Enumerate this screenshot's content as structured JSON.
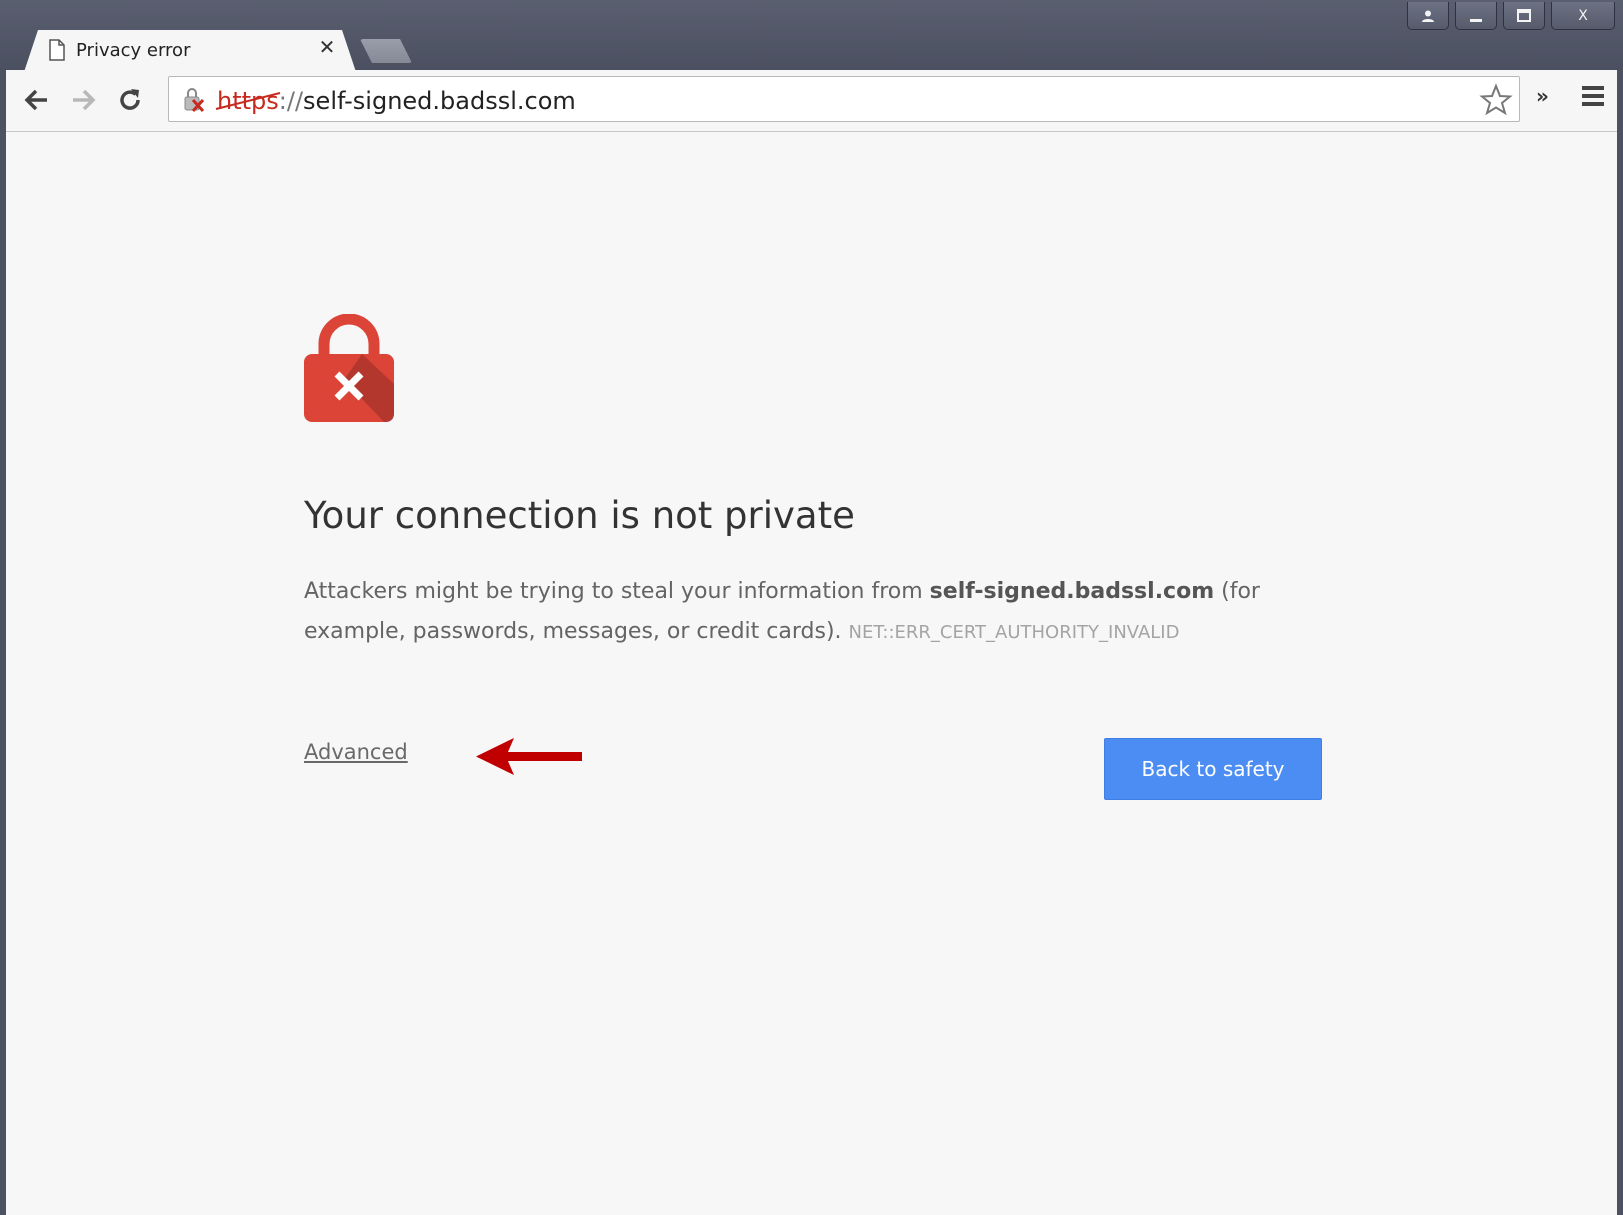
{
  "window": {
    "controls": [
      "profile",
      "minimize",
      "maximize",
      "close"
    ],
    "close_label": "X"
  },
  "tab": {
    "title": "Privacy error",
    "close_glyph": "✕",
    "icon": "page-icon"
  },
  "toolbar": {
    "url_scheme": "https",
    "url_separator": "://",
    "url_host": "self-signed.badssl.com",
    "extensions_glyph": "»"
  },
  "interstitial": {
    "heading": "Your connection is not private",
    "body_prefix": "Attackers might be trying to steal your information from ",
    "body_host": "self-signed.badssl.com",
    "body_suffix": " (for example, passwords, messages, or credit cards).",
    "error_code": "NET::ERR_CERT_AUTHORITY_INVALID",
    "advanced_link": "Advanced",
    "back_button": "Back to safety"
  },
  "colors": {
    "accent_button": "#4c8df4",
    "error_red": "#db4437",
    "annotation_arrow": "#c00000"
  }
}
